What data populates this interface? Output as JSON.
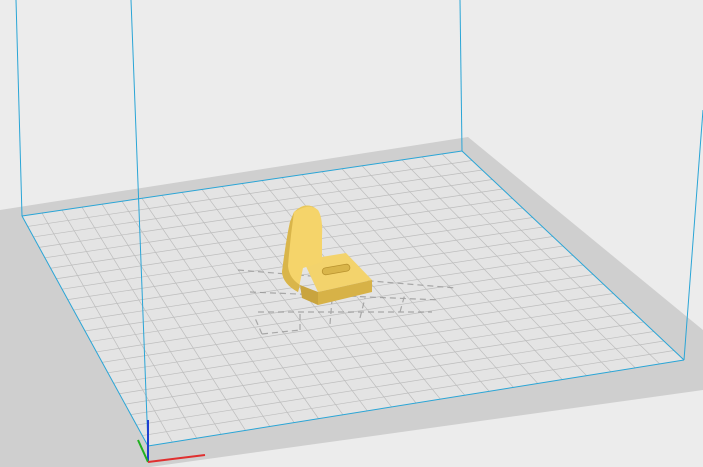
{
  "app": {
    "view": "3d-build-plate-viewport"
  },
  "colors": {
    "background": "#ececec",
    "plate_border": "#c8c8c8",
    "plate_surface": "#e2e2e2",
    "grid_line": "#bdbdbd",
    "build_volume_line": "#2aa5d6",
    "model_fill": "#f5d46a",
    "model_shade": "#d9b54a",
    "model_dark": "#b8922e",
    "shadow": "#9a9a9a",
    "axis_x": "#e03030",
    "axis_y": "#20b020",
    "axis_z": "#2040d0"
  },
  "scene": {
    "model": {
      "name": "bracket-model",
      "description_icon": "l-bracket-icon"
    },
    "axes": [
      "x-axis",
      "y-axis",
      "z-axis"
    ]
  }
}
